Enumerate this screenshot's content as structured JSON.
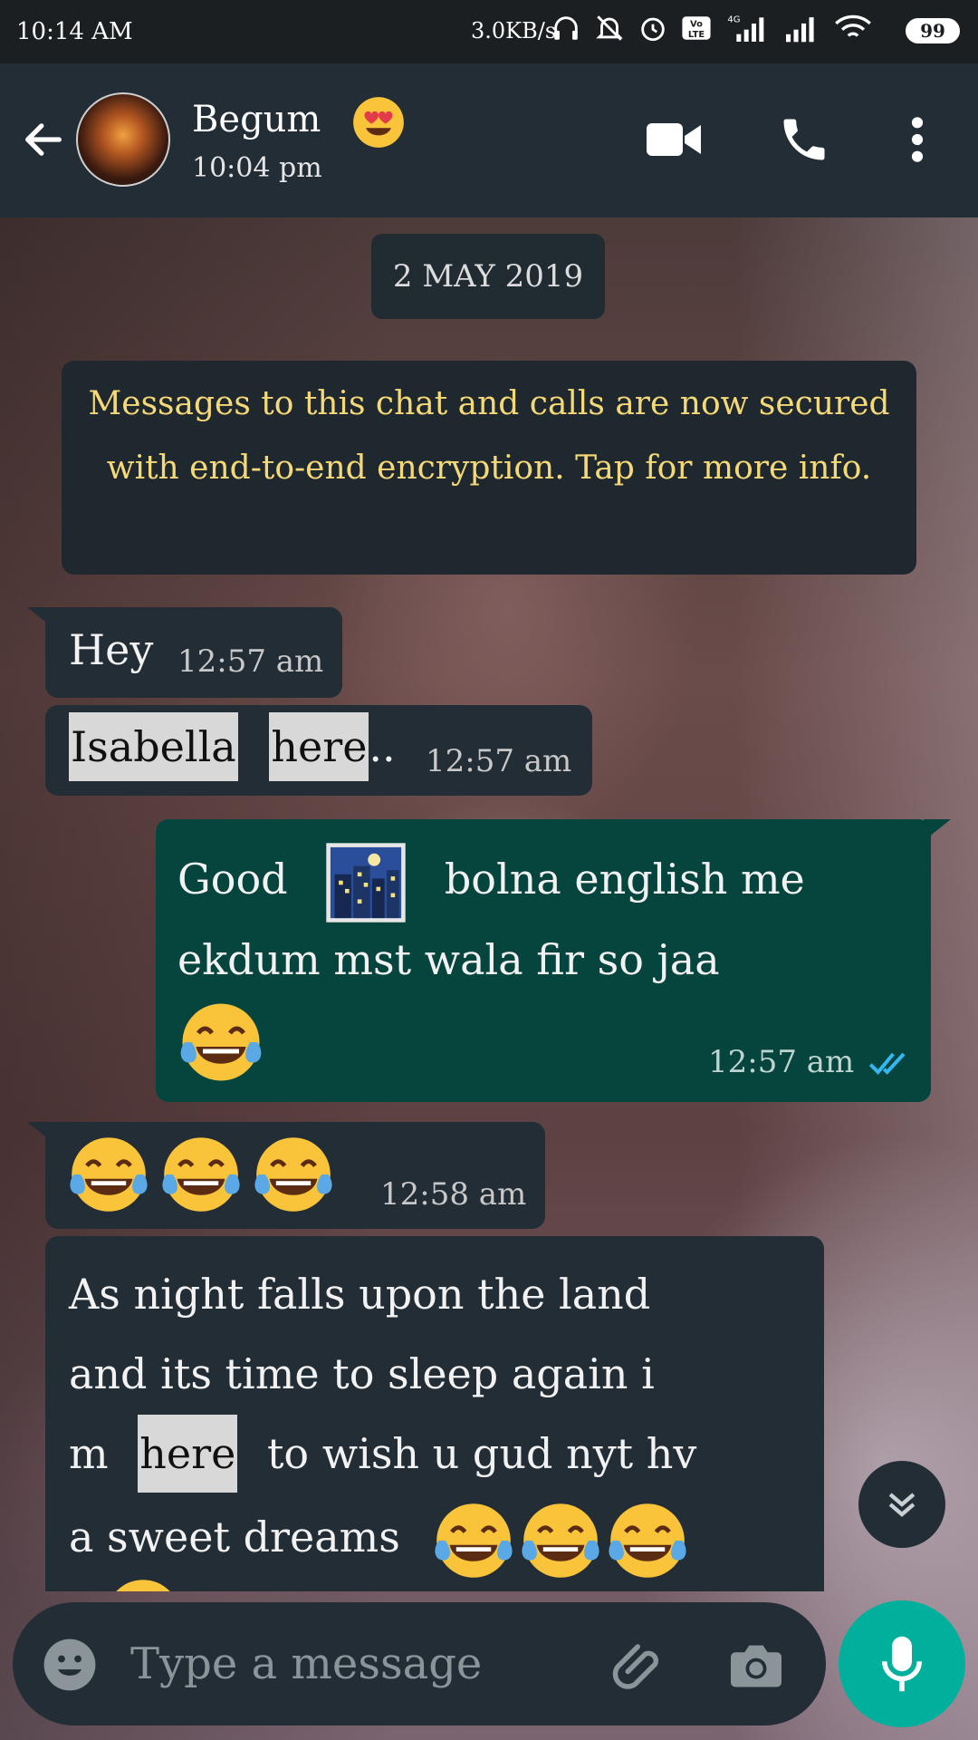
{
  "status_bar": {
    "time": "10:14 AM",
    "network_speed": "3.0KB/s",
    "battery": "99"
  },
  "header": {
    "contact_name": "Begum",
    "last_seen": "10:04 pm",
    "icons": [
      "back-arrow-icon",
      "video-call-icon",
      "voice-call-icon",
      "more-options-icon"
    ]
  },
  "chat": {
    "date_chip": "2 MAY 2019",
    "encryption_notice": "Messages to this chat and calls are now secured with end-to-end encryption. Tap for more info.",
    "messages": [
      {
        "direction": "in",
        "text": "Hey",
        "time": "12:57 am"
      },
      {
        "direction": "in",
        "word1": "Isabella",
        "word2": "here",
        "tail": "..",
        "time": "12:57 am"
      },
      {
        "direction": "out",
        "line1_a": "Good",
        "line1_b": "bolna english me",
        "line2": "ekdum mst wala fir so jaa",
        "time": "12:57 am",
        "read": true
      },
      {
        "direction": "in",
        "time": "12:58 am"
      },
      {
        "direction": "in",
        "line1": "As night falls upon the land",
        "line2": "and its time to sleep again i",
        "line3_a": "m",
        "line3_hl": "here",
        "line3_b": "to wish u gud nyt hv",
        "line4": "a sweet dreams"
      }
    ]
  },
  "composer": {
    "placeholder": "Type a message"
  },
  "colors": {
    "header": "#232d36",
    "incoming_bubble": "#232d35",
    "outgoing_bubble": "#06443e",
    "notice_text": "#f6d977",
    "mic_button": "#00af9c",
    "read_ticks": "#34b7f1"
  }
}
